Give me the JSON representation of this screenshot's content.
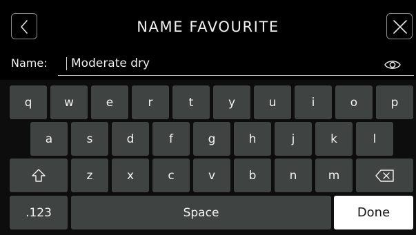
{
  "header": {
    "title": "NAME FAVOURITE",
    "back_icon": "chevron-left-icon",
    "close_icon": "close-icon"
  },
  "name_field": {
    "label": "Name:",
    "value": "Moderate dry",
    "visibility_icon": "eye-icon"
  },
  "keyboard": {
    "row1": [
      "q",
      "w",
      "e",
      "r",
      "t",
      "y",
      "u",
      "i",
      "o",
      "p"
    ],
    "row2": [
      "a",
      "s",
      "d",
      "f",
      "g",
      "h",
      "j",
      "k",
      "l"
    ],
    "row3": [
      "z",
      "x",
      "c",
      "v",
      "b",
      "n",
      "m"
    ],
    "shift_icon": "shift-arrow-icon",
    "backspace_icon": "backspace-icon",
    "numbers_label": ".123",
    "space_label": "Space",
    "done_label": "Done"
  },
  "colors": {
    "background": "#000000",
    "key": "#3f4442",
    "done_key": "#ffffff",
    "text": "#f2f2f2"
  }
}
